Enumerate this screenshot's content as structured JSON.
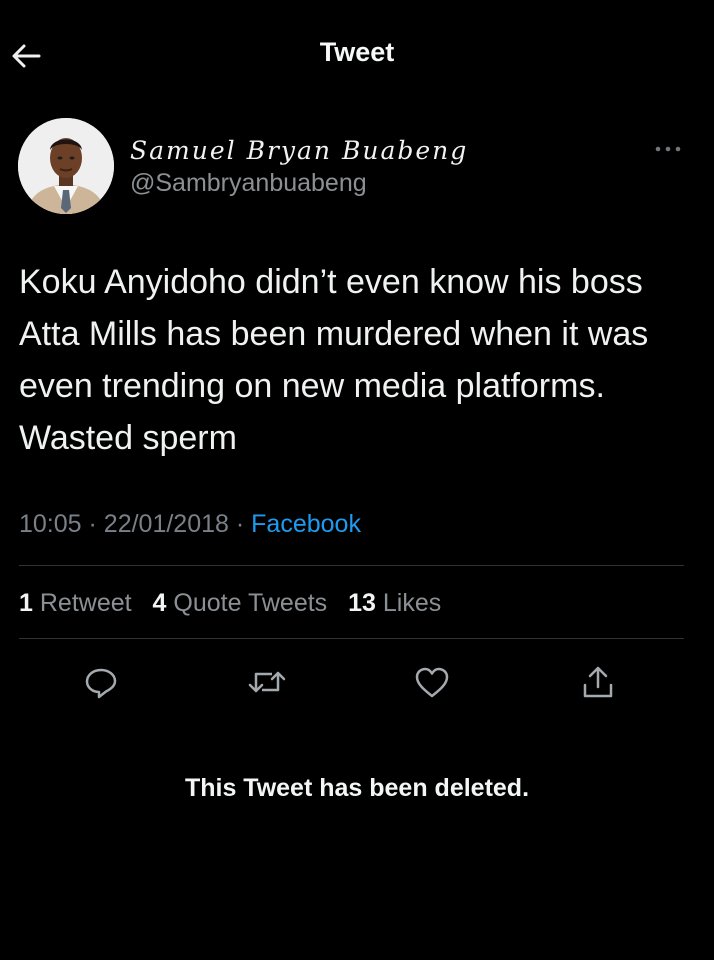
{
  "header": {
    "title": "Tweet",
    "back_icon": "arrow-left-icon"
  },
  "author": {
    "display_name": "Samuel Bryan Buabeng",
    "handle": "@Sambryanbuabeng",
    "more_icon": "more-horizontal-icon"
  },
  "tweet": {
    "text": "Koku Anyidoho didn’t even know his boss Atta Mills has been murdered when it was even trending on new media platforms. Wasted sperm",
    "time": "10:05",
    "date": "22/01/2018",
    "source": "Facebook",
    "separator": "·"
  },
  "stats": {
    "retweets_count": "1",
    "retweets_label": "Retweet",
    "quote_count": "4",
    "quote_label": "Quote Tweets",
    "likes_count": "13",
    "likes_label": "Likes"
  },
  "actions": [
    "reply-icon",
    "retweet-icon",
    "like-icon",
    "share-icon"
  ],
  "notice": "This Tweet has been deleted.",
  "colors": {
    "background": "#000000",
    "accent": "#1d9bf0",
    "divider": "#2f3336",
    "muted": "#8b9095"
  }
}
